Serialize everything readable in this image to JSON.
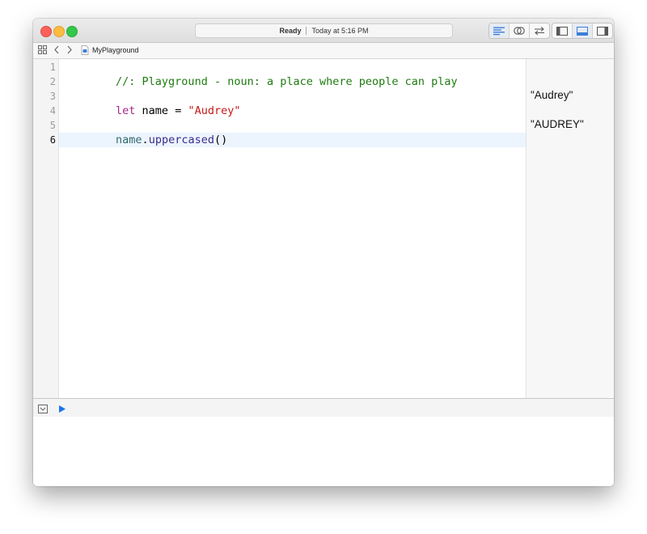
{
  "toolbar": {
    "activity": {
      "status": "Ready",
      "time": "Today at 5:16 PM"
    }
  },
  "jumpbar": {
    "file_name": "MyPlayground"
  },
  "editor": {
    "line_numbers": [
      "1",
      "2",
      "3",
      "4",
      "5",
      "6"
    ],
    "current_line": "6",
    "lines": {
      "l1": {
        "comment": "//: Playground - noun: a place where people can play"
      },
      "l3": {
        "keyword": "let",
        "plain1": " name = ",
        "string": "\"Audrey\""
      },
      "l5": {
        "ident": "name",
        "dot": ".",
        "method": "uppercased",
        "parens": "()"
      }
    }
  },
  "results": {
    "r3": "\"Audrey\"",
    "r5": "\"AUDREY\""
  },
  "colors": {
    "comment": "#1e7b10",
    "keyword": "#a0288a",
    "string": "#c41a16",
    "method": "#3a2c8a",
    "current_line_highlight": "#ecf5fe",
    "run_button": "#1a73e8"
  }
}
